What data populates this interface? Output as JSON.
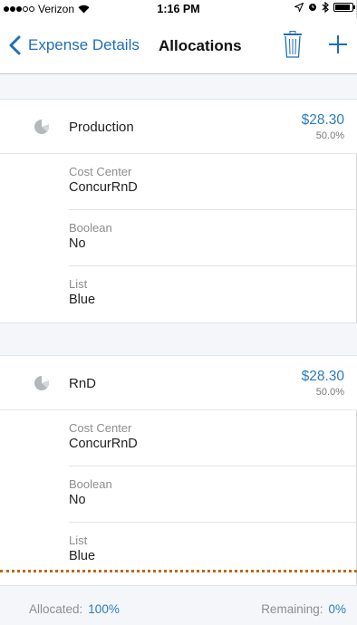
{
  "status_bar": {
    "carrier": "Verizon",
    "time": "1:16 PM"
  },
  "nav": {
    "back_label": "Expense Details",
    "title": "Allocations"
  },
  "allocations": [
    {
      "name": "Production",
      "amount": "$28.30",
      "percent": "50.0%",
      "fields": [
        {
          "label": "Cost Center",
          "value": "ConcurRnD"
        },
        {
          "label": "Boolean",
          "value": "No"
        },
        {
          "label": "List",
          "value": "Blue"
        }
      ]
    },
    {
      "name": "RnD",
      "amount": "$28.30",
      "percent": "50.0%",
      "fields": [
        {
          "label": "Cost Center",
          "value": "ConcurRnD"
        },
        {
          "label": "Boolean",
          "value": "No"
        },
        {
          "label": "List",
          "value": "Blue"
        }
      ]
    }
  ],
  "footer": {
    "allocated_label": "Allocated:",
    "allocated_value": "100%",
    "remaining_label": "Remaining:",
    "remaining_value": "0%"
  },
  "colors": {
    "accent": "#2b7bbf",
    "section_bg": "#f4f6f9",
    "dotted_divider": "#c0660f"
  },
  "icons": [
    "signal-dots-icon",
    "wifi-icon",
    "location-arrow-icon",
    "alarm-icon",
    "bluetooth-icon",
    "battery-icon",
    "back-chevron-icon",
    "trash-icon",
    "plus-icon",
    "pie-chart-icon"
  ]
}
